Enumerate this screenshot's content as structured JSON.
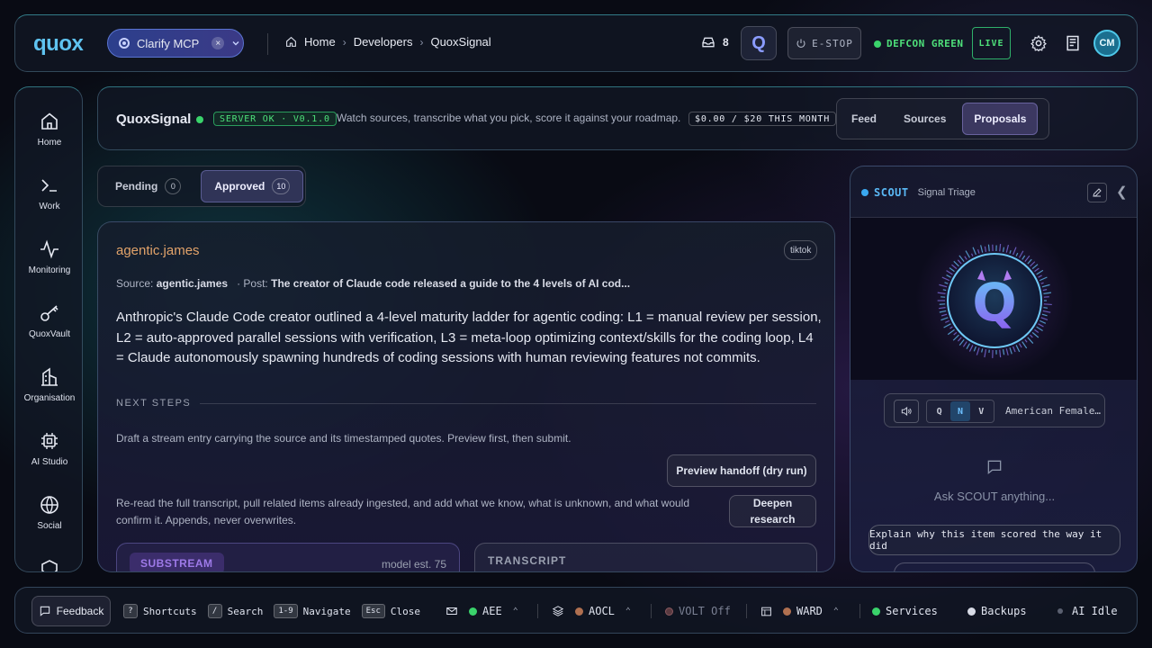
{
  "topbar": {
    "logo": "quox",
    "context_pill": "Clarify MCP",
    "breadcrumbs": [
      "Home",
      "Developers",
      "QuoxSignal"
    ],
    "inbox_count": "8",
    "q_badge": "Q",
    "estop": "E-STOP",
    "defcon": "DEFCON GREEN",
    "live": "LIVE",
    "avatar": "CM"
  },
  "sidebar": {
    "items": [
      {
        "label": "Home",
        "icon": "home-icon"
      },
      {
        "label": "Work",
        "icon": "terminal-icon"
      },
      {
        "label": "Monitoring",
        "icon": "activity-icon"
      },
      {
        "label": "QuoxVault",
        "icon": "key-icon"
      },
      {
        "label": "Organisation",
        "icon": "building-icon"
      },
      {
        "label": "AI Studio",
        "icon": "chip-icon"
      },
      {
        "label": "Social",
        "icon": "globe-icon"
      }
    ]
  },
  "header": {
    "title": "QuoxSignal",
    "server_badge": "SERVER OK · V0.1.0",
    "description": "Watch sources, transcribe what you pick, score it against your roadmap.",
    "budget": "$0.00 / $20 THIS MONTH",
    "tabs": [
      "Feed",
      "Sources",
      "Proposals"
    ],
    "active_tab": "Proposals"
  },
  "filter": {
    "pending_label": "Pending",
    "pending_count": "0",
    "approved_label": "Approved",
    "approved_count": "10"
  },
  "card": {
    "title": "agentic.james",
    "platform": "tiktok",
    "source_label": "Source:",
    "source_value": "agentic.james",
    "post_label": "· Post:",
    "post_value": "The creator of Claude code released a guide to the 4 levels of AI cod...",
    "summary": "Anthropic's Claude Code creator outlined a 4-level maturity ladder for agentic coding: L1 = manual review per session, L2 = auto-approved parallel sessions with verification, L3 = meta-loop optimizing context/skills for the coding loop, L4 = Claude autonomously spawning hundreds of coding sessions with human reviewing features not commits.",
    "next_steps_heading": "NEXT STEPS",
    "step1_text": "Draft a stream entry carrying the source and its timestamped quotes. Preview first, then submit.",
    "step1_button": "Preview handoff (dry run)",
    "step2_text": "Re-read the full transcript, pull related items already ingested, and add what we know, what is unknown, and what would confirm it. Appends, never overwrites.",
    "step2_button": "Deepen research",
    "substream_label": "SUBSTREAM",
    "model_est": "model est. 75",
    "transcript_label": "TRANSCRIPT"
  },
  "scout": {
    "name": "SCOUT",
    "subtitle": "Signal Triage",
    "voice_options": [
      "Q",
      "N",
      "V"
    ],
    "voice_selected": "N",
    "voice_name": "American Female…",
    "ask_placeholder": "Ask SCOUT anything...",
    "suggestion": "Explain why this item scored the way it did"
  },
  "statusbar": {
    "feedback": "Feedback",
    "shortcuts_key": "?",
    "shortcuts": "Shortcuts",
    "search_key": "/",
    "search": "Search",
    "navigate_key": "1-9",
    "navigate": "Navigate",
    "close_key": "Esc",
    "close": "Close",
    "aee": "AEE",
    "aocl": "AOCL",
    "volt": "VOLT Off",
    "ward": "WARD",
    "services": "Services",
    "backups": "Backups",
    "ai": "AI Idle"
  },
  "colors": {
    "accent_cyan": "#5fc3f0",
    "status_green": "#3ad36b",
    "title_orange": "#e2a36a",
    "substream_purple": "#9e7ae8"
  }
}
